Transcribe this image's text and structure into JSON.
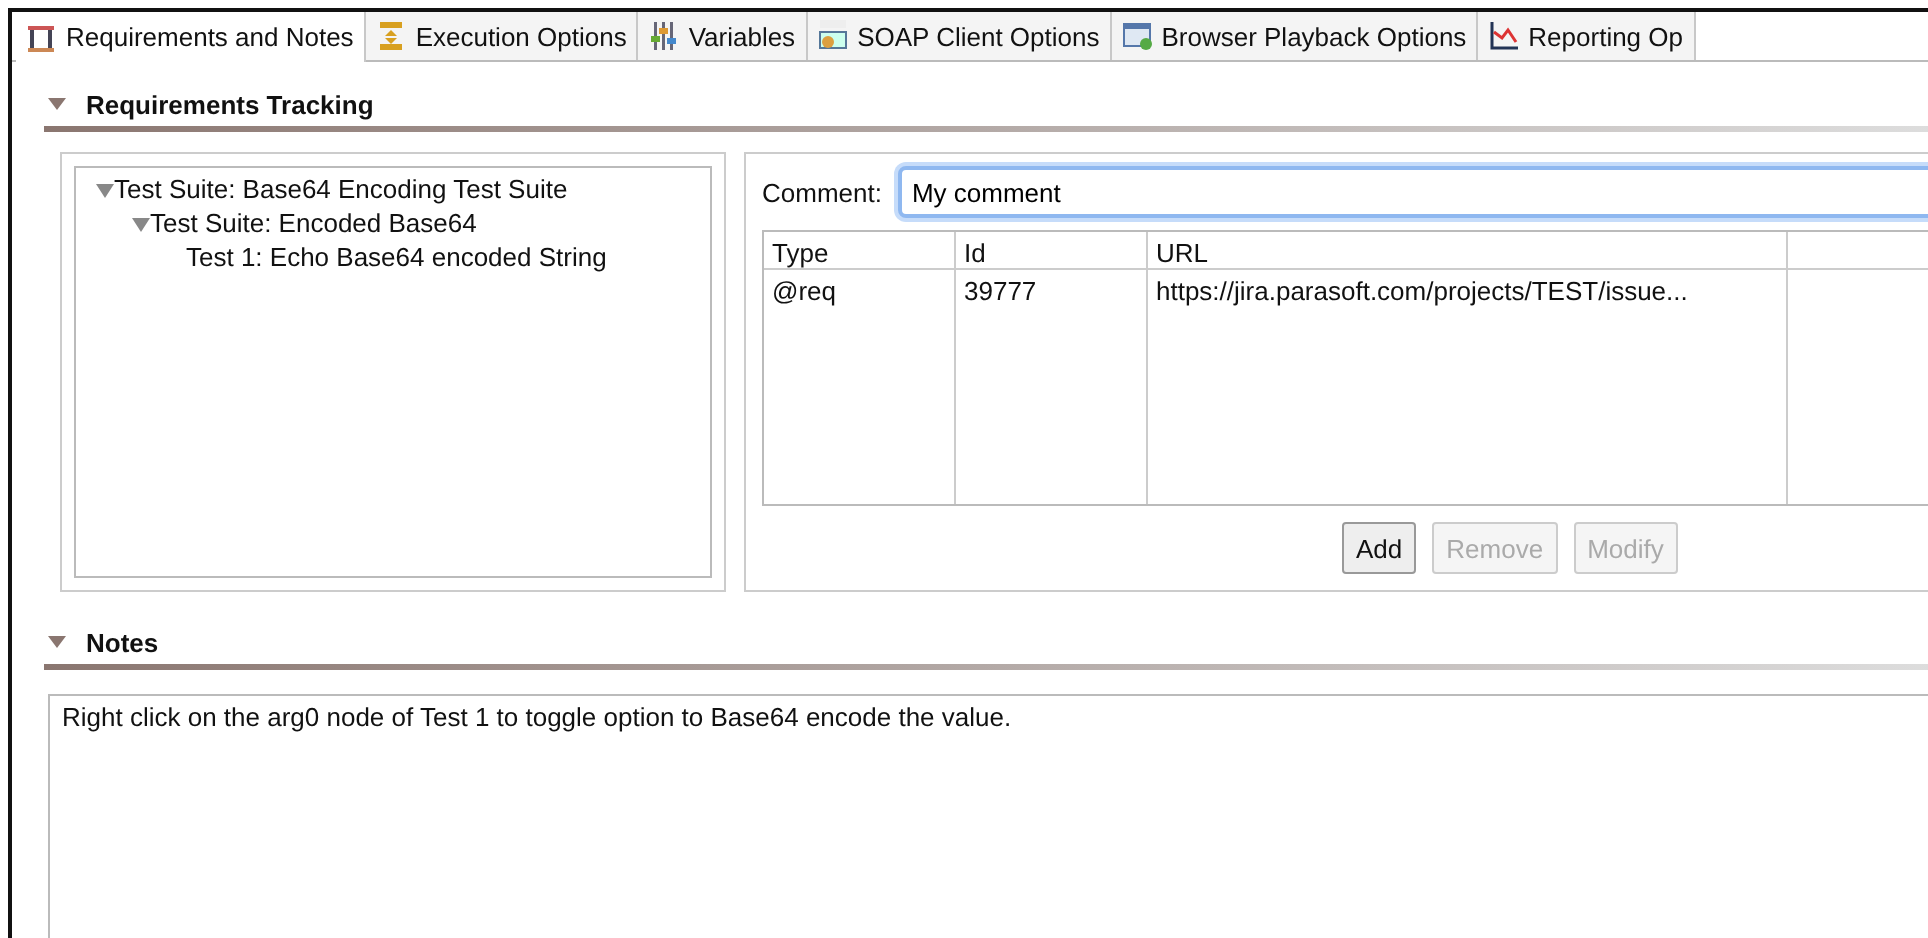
{
  "tabs": [
    {
      "label": "Requirements and Notes",
      "selected": true,
      "kind": "requirements"
    },
    {
      "label": "Execution Options",
      "selected": false,
      "kind": "execution"
    },
    {
      "label": "Variables",
      "selected": false,
      "kind": "variables"
    },
    {
      "label": "SOAP Client Options",
      "selected": false,
      "kind": "soap"
    },
    {
      "label": "Browser Playback Options",
      "selected": false,
      "kind": "browser"
    },
    {
      "label": "Reporting Op",
      "selected": false,
      "kind": "reporting"
    }
  ],
  "requirements_tracking": {
    "title": "Requirements Tracking",
    "expanded": true,
    "tree": [
      {
        "label": "Test Suite: Base64 Encoding Test Suite",
        "expanded": true,
        "children": [
          {
            "label": "Test Suite: Encoded Base64",
            "expanded": true,
            "children": [
              {
                "label": "Test 1: Echo Base64 encoded String"
              }
            ]
          }
        ]
      }
    ],
    "comment": {
      "label": "Comment:",
      "value": "My comment"
    },
    "table": {
      "columns": [
        "Type",
        "Id",
        "URL"
      ],
      "rows": [
        [
          "@req",
          "39777",
          "https://jira.parasoft.com/projects/TEST/issue..."
        ]
      ]
    },
    "buttons": [
      {
        "label": "Add",
        "disabled": false
      },
      {
        "label": "Remove",
        "disabled": true
      },
      {
        "label": "Modify",
        "disabled": true
      }
    ]
  },
  "notes": {
    "title": "Notes",
    "expanded": true,
    "text": "Right click on the arg0 node of Test 1 to toggle option to Base64 encode the value."
  }
}
